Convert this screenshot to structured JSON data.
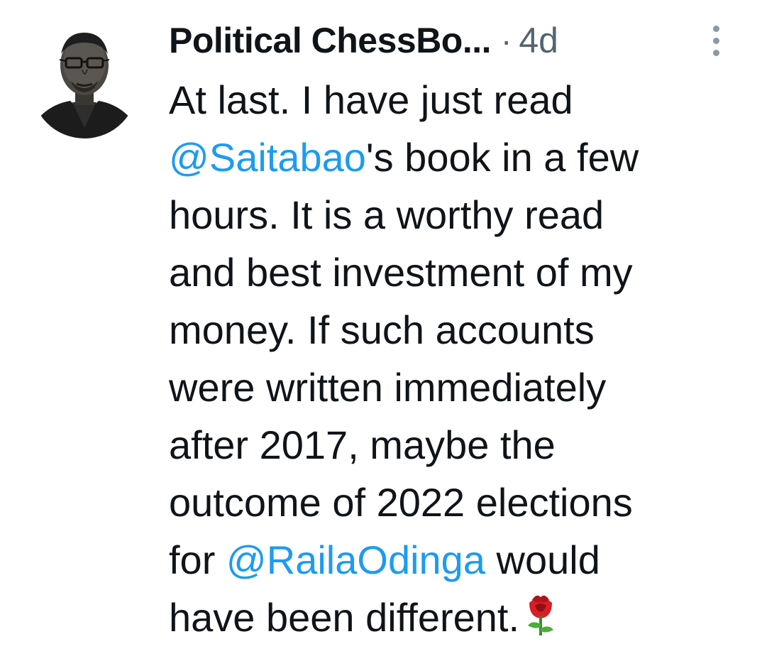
{
  "tweet": {
    "author_name": "Political ChessBo...",
    "separator": "·",
    "timestamp": "4d",
    "text": {
      "l1": "At last. I have just read",
      "l2_mention": "@Saitabao",
      "l2_rest": "'s book in a few",
      "l3": "hours. It is a worthy read",
      "l4": "and best investment of my",
      "l5": "money. If such accounts",
      "l6": "were written immediately",
      "l7": "after 2017, maybe the",
      "l8": "outcome of 2022 elections",
      "l9_pre": "for ",
      "l9_mention": "@RailaOdinga",
      "l9_post": " would",
      "l10": "have been different."
    },
    "emoji": "rose-icon"
  },
  "colors": {
    "mention": "#1d9bf0",
    "text": "#0f1419",
    "secondary": "#536471"
  }
}
